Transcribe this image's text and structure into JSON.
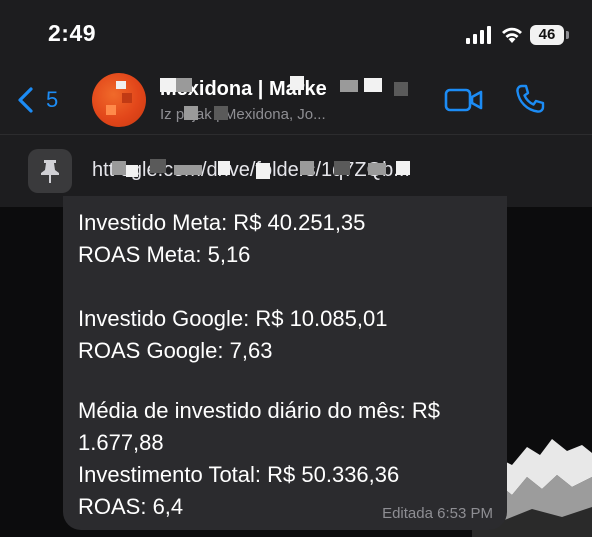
{
  "status_bar": {
    "time": "2:49",
    "battery": "46"
  },
  "header": {
    "back_count": "5",
    "contact_name": "Mexidona | Marke",
    "contact_subtitle": "Iz                pejak | Mexidona, Jo..."
  },
  "pinned": {
    "text": "htt              ogle.com/drive/folders/1q7ZQb..."
  },
  "message": {
    "lines": [
      "Investido Meta: R$ 40.251,35",
      "ROAS Meta: 5,16",
      "Investido Google: R$ 10.085,01",
      "ROAS Google: 7,63",
      "Média de investido diário do mês: R$",
      "1.677,88",
      "Investimento Total: R$ 50.336,36",
      "ROAS:  6,4"
    ],
    "edited_label": "Editada",
    "timestamp": "6:53 PM"
  },
  "colors": {
    "accent": "#1c8cf5",
    "header_bg": "#1d1d1f",
    "bubble_bg": "#2b2b2e",
    "meta_text": "#8e8e93"
  }
}
